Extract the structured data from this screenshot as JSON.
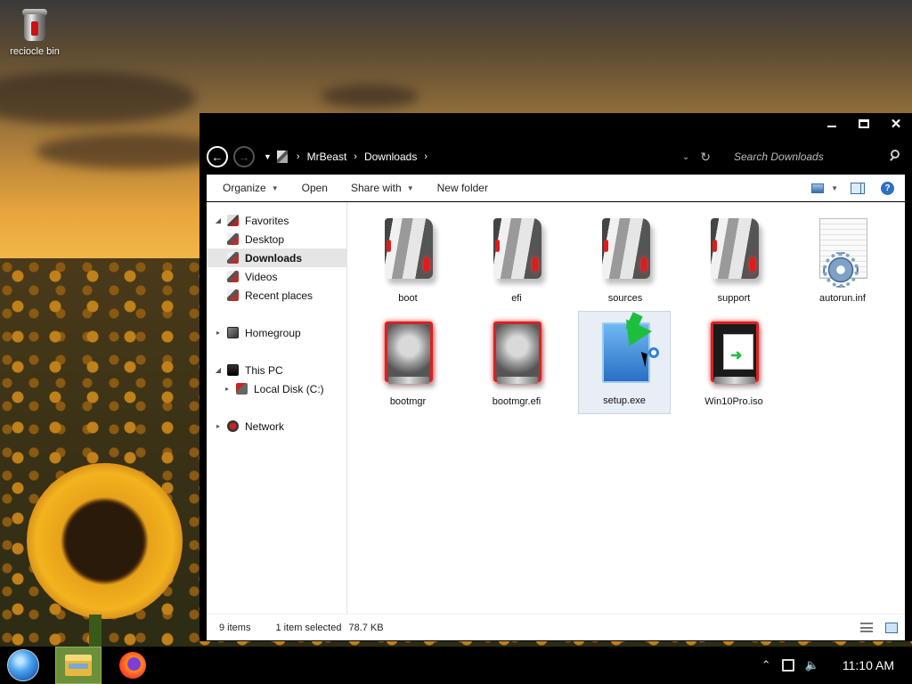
{
  "desktop": {
    "icons": [
      {
        "label": "reciocle bin",
        "icon": "recycle-bin-icon"
      }
    ]
  },
  "window": {
    "controls": {
      "minimize": "minimize",
      "maximize": "maximize",
      "close": "✕"
    },
    "breadcrumb": [
      "MrBeast",
      "Downloads"
    ],
    "search_placeholder": "Search Downloads",
    "commands": [
      {
        "label": "Organize",
        "dropdown": true
      },
      {
        "label": "Open",
        "dropdown": false
      },
      {
        "label": "Share with",
        "dropdown": true
      },
      {
        "label": "New folder",
        "dropdown": false
      }
    ],
    "nav": {
      "favorites": "Favorites",
      "desktop": "Desktop",
      "downloads": "Downloads",
      "videos": "Videos",
      "recent": "Recent places",
      "homegroup": "Homegroup",
      "thispc": "This PC",
      "localdisk": "Local Disk (C:)",
      "network": "Network"
    },
    "files": [
      {
        "name": "boot",
        "type": "folder"
      },
      {
        "name": "efi",
        "type": "folder"
      },
      {
        "name": "sources",
        "type": "folder"
      },
      {
        "name": "support",
        "type": "folder"
      },
      {
        "name": "autorun.inf",
        "type": "settings-file"
      },
      {
        "name": "bootmgr",
        "type": "system-file"
      },
      {
        "name": "bootmgr.efi",
        "type": "system-file"
      },
      {
        "name": "setup.exe",
        "type": "installer",
        "selected": true
      },
      {
        "name": "Win10Pro.iso",
        "type": "disc-image"
      }
    ],
    "status": {
      "count": "9 items",
      "selection": "1 item selected",
      "size": "78.7 KB"
    }
  },
  "taskbar": {
    "apps": [
      "start-orb",
      "file-explorer",
      "firefox"
    ],
    "clock": "11:10 AM"
  },
  "colors": {
    "accent_red": "#d32424",
    "selection": "#e8eef6",
    "taskbar_active": "#6b8f3a"
  }
}
